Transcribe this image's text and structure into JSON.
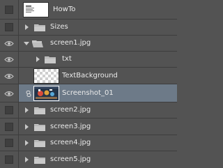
{
  "layers": [
    {
      "name": "HowTo",
      "visible": false,
      "kind": "layer",
      "thumb": "document-thumbnail"
    },
    {
      "name": "Sizes",
      "visible": false,
      "kind": "group",
      "expanded": false
    },
    {
      "name": "screen1.jpg",
      "visible": true,
      "kind": "group",
      "expanded": true
    },
    {
      "name": "txt",
      "visible": true,
      "kind": "group",
      "expanded": false
    },
    {
      "name": "TextBackground",
      "visible": true,
      "kind": "layer",
      "thumb": "transparency-thumbnail"
    },
    {
      "name": "Screenshot_01",
      "visible": true,
      "kind": "layer",
      "thumb": "screenshot-thumbnail",
      "selected": true
    },
    {
      "name": "screen2.jpg",
      "visible": false,
      "kind": "group",
      "expanded": false
    },
    {
      "name": "screen3.jpg",
      "visible": false,
      "kind": "group",
      "expanded": false
    },
    {
      "name": "screen4.jpg",
      "visible": false,
      "kind": "group",
      "expanded": false
    },
    {
      "name": "screen5.jpg",
      "visible": false,
      "kind": "group",
      "expanded": false
    }
  ],
  "colors": {
    "panel": "#535353",
    "selection": "#6d7a88",
    "separator": "#3d3d3d"
  }
}
